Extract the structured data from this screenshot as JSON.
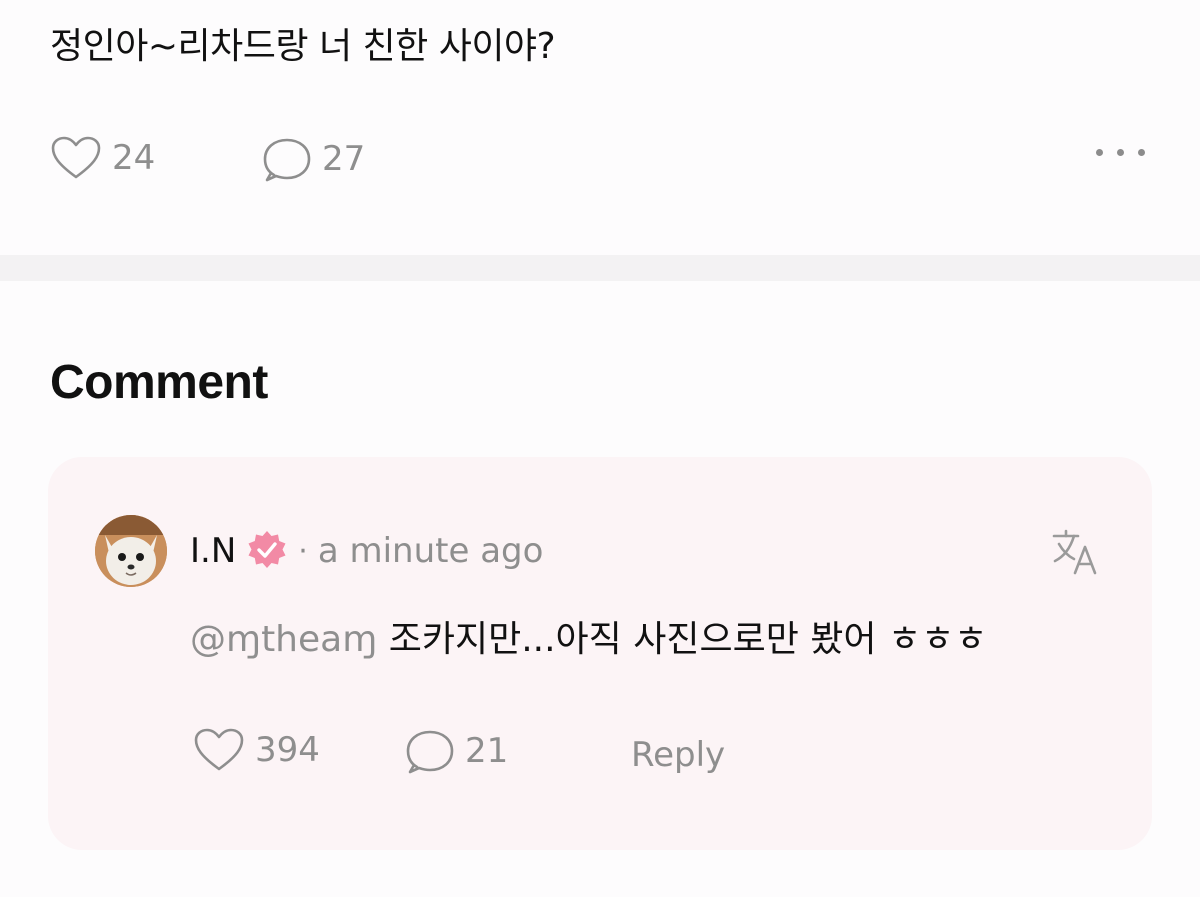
{
  "post": {
    "text": "정인아~리차드랑 너 친한 사이야?",
    "like_count": "24",
    "comment_count": "27"
  },
  "section": {
    "title": "Comment"
  },
  "comment": {
    "author": "I.N",
    "separator": "·",
    "time": "a minute ago",
    "mention": "@ɱtheaɱ",
    "text": " 조카지만...아직 사진으로만 봤어 ㅎㅎㅎ",
    "like_count": "394",
    "reply_count": "21",
    "reply_label": "Reply"
  },
  "colors": {
    "verified_badge": "#f28aa5",
    "card_bg": "#fcf4f6",
    "muted": "#8e8e8e"
  }
}
